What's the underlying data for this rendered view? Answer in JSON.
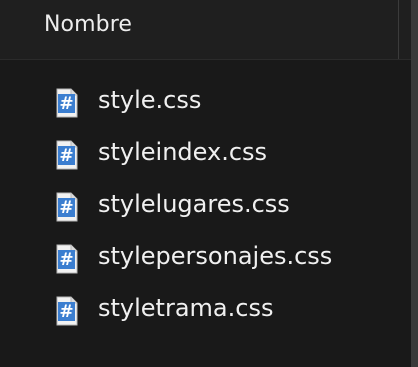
{
  "header": {
    "column_label": "Nombre"
  },
  "files": [
    {
      "name": "style.css",
      "icon": "css-file-icon"
    },
    {
      "name": "styleindex.css",
      "icon": "css-file-icon"
    },
    {
      "name": "stylelugares.css",
      "icon": "css-file-icon"
    },
    {
      "name": "stylepersonajes.css",
      "icon": "css-file-icon"
    },
    {
      "name": "styletrama.css",
      "icon": "css-file-icon"
    }
  ],
  "colors": {
    "background": "#191919",
    "icon_blue": "#3b7ed0",
    "icon_page": "#f2f2f2",
    "text": "#f0f0f0"
  }
}
